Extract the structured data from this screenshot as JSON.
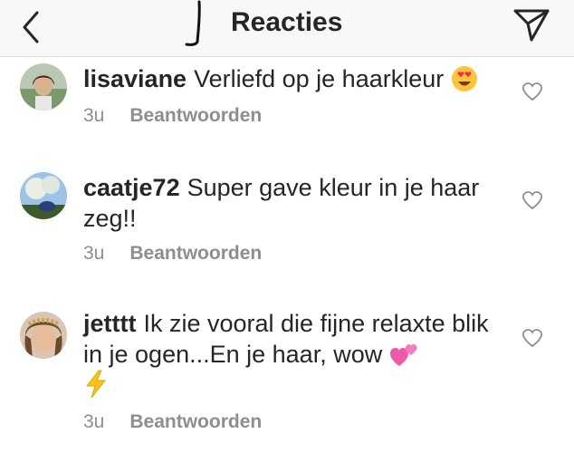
{
  "header": {
    "title": "Reacties"
  },
  "comments": [
    {
      "username": "lisaviane",
      "text": "Verliefd op je haarkleur",
      "time": "3u",
      "reply_label": "Beantwoorden",
      "emoji": "heart-eyes"
    },
    {
      "username": "caatje72",
      "text": "Super gave kleur in je haar zeg!!",
      "time": "3u",
      "reply_label": "Beantwoorden"
    },
    {
      "username": "jetttt",
      "text": "Ik zie vooral die fijne relaxte blik in je ogen...En je haar, wow",
      "time": "3u",
      "reply_label": "Beantwoorden",
      "emoji": "two-hearts, lightning"
    }
  ],
  "icons": {
    "back": "chevron-left-icon",
    "send": "paper-plane-icon",
    "like": "heart-outline-icon"
  },
  "colors": {
    "text": "#262626",
    "meta": "#8e8e8e",
    "header_bg": "#f8f8f8"
  }
}
